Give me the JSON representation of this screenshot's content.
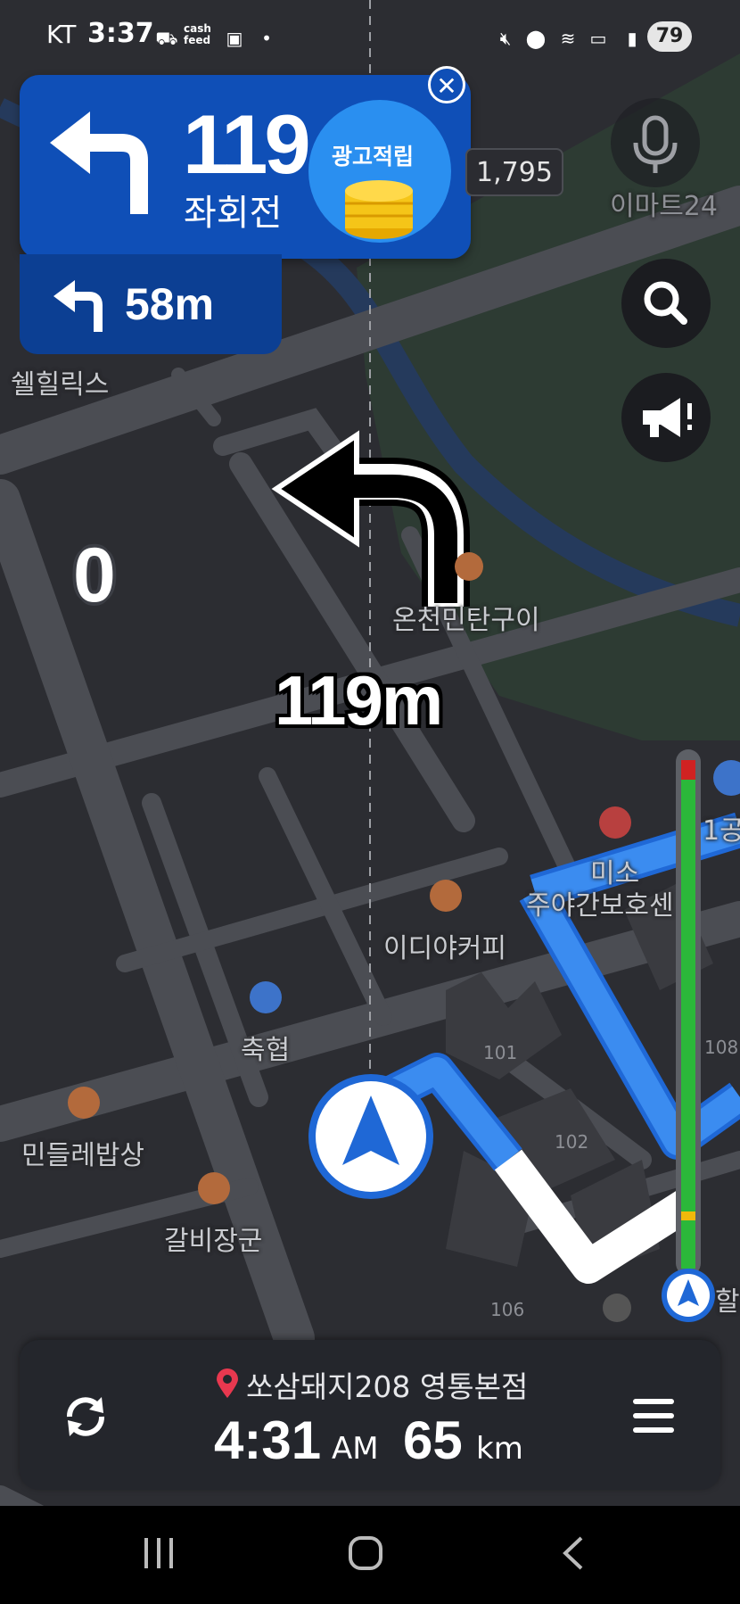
{
  "status_bar": {
    "carrier": "KT",
    "time": "3:37",
    "app_badge": "cash\nfeed",
    "battery": "79"
  },
  "turn_banner": {
    "distance": "119",
    "road": "좌회전",
    "ad_label": "광고적립",
    "next_distance": "58m"
  },
  "map": {
    "price_tag": "1,795",
    "current_speed": "0",
    "turn_distance": "119m",
    "labels": {
      "emart24": "이마트24",
      "shell_hills": "쉘힐릭스",
      "charcoal_bbq": "온천민탄구이",
      "miso_daycare_1": "미소",
      "miso_daycare_2": "주야간보호센",
      "ediya": "이디야커피",
      "nonghyup": "축협",
      "dandelion": "민들레밥상",
      "galbi": "갈비장군",
      "parking_1": "1공",
      "right_edge": "할"
    },
    "buildings": [
      "101",
      "102",
      "106",
      "108"
    ]
  },
  "bottom_panel": {
    "destination": "쏘삼돼지208 영통본점",
    "eta_time": "4:31",
    "eta_ampm": "AM",
    "remaining_distance": "65",
    "distance_unit": "km"
  },
  "colors": {
    "banner_blue": "#0f4fb7",
    "route_blue": "#3b8cf0",
    "traffic_green": "#2bb83a"
  }
}
